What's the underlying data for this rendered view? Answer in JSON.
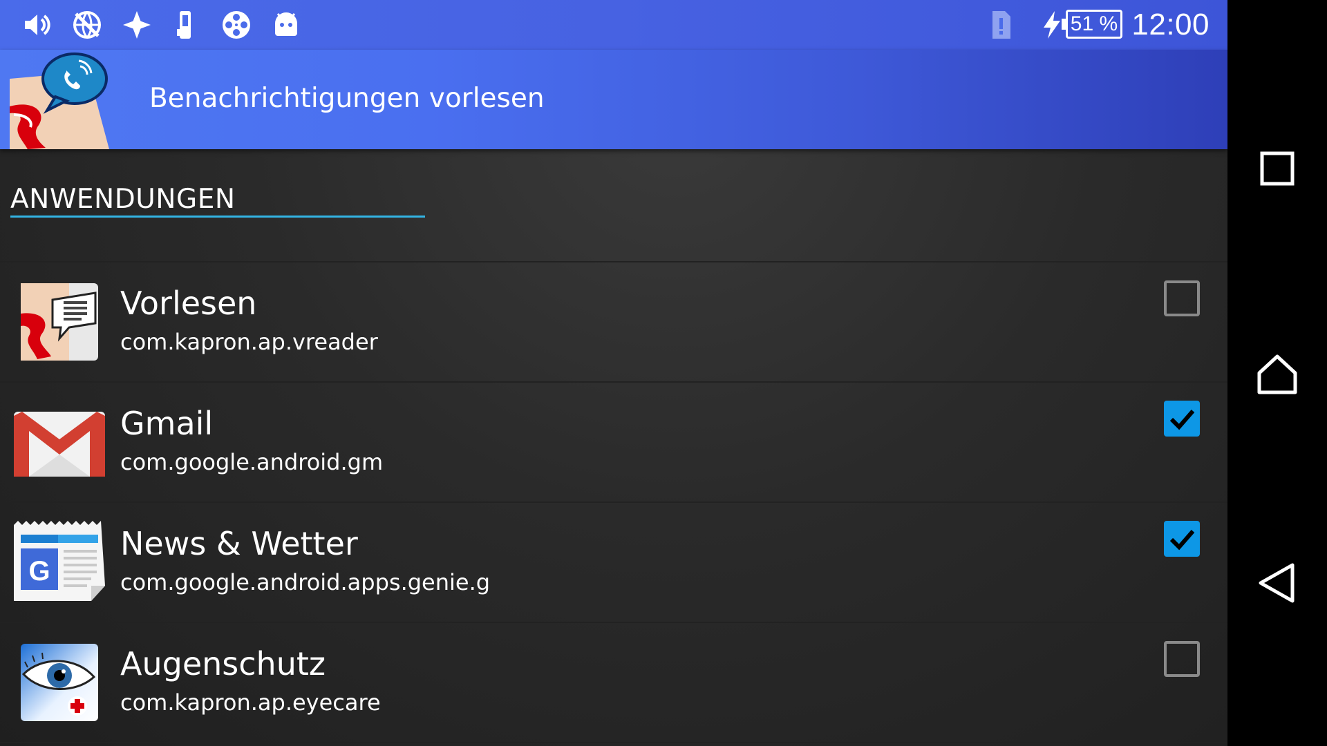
{
  "status_bar": {
    "icons": [
      "volume-icon",
      "network-off-icon",
      "fan-icon",
      "phone-icon",
      "film-reel-icon",
      "android-icon",
      "sim-alert-icon",
      "charging-icon"
    ],
    "battery": "51 %",
    "time": "12:00"
  },
  "action_bar": {
    "title": "Benachrichtigungen vorlesen"
  },
  "section": {
    "title": "ANWENDUNGEN"
  },
  "apps": [
    {
      "name": "Vorlesen",
      "package": "com.kapron.ap.vreader",
      "checked": false,
      "icon": "vorlesen-app-icon"
    },
    {
      "name": "Gmail",
      "package": "com.google.android.gm",
      "checked": true,
      "icon": "gmail-app-icon"
    },
    {
      "name": "News & Wetter",
      "package": "com.google.android.apps.genie.g",
      "checked": true,
      "icon": "news-app-icon"
    },
    {
      "name": "Augenschutz",
      "package": "com.kapron.ap.eyecare",
      "checked": false,
      "icon": "eye-app-icon"
    }
  ],
  "colors": {
    "accent": "#0d97e6",
    "section_underline": "#33b5e5",
    "action_bar": "#4a6ff0"
  },
  "nav": [
    "recents-icon",
    "home-icon",
    "back-icon"
  ]
}
